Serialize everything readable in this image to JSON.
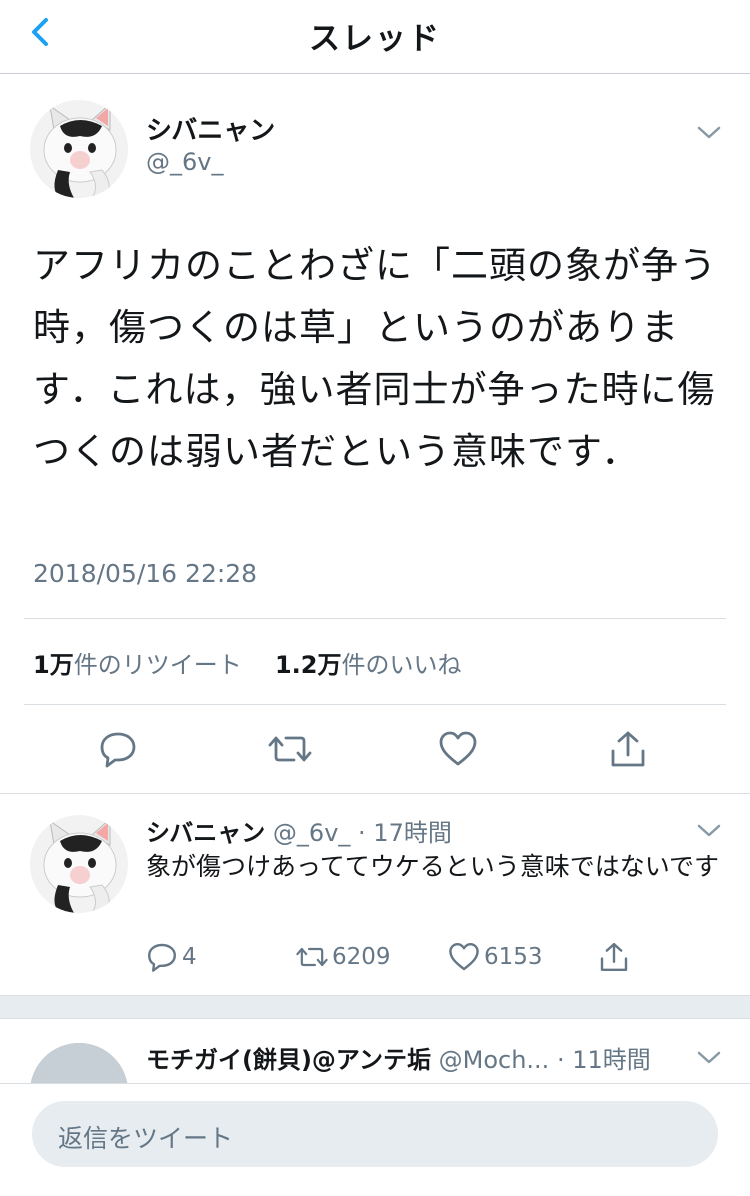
{
  "header": {
    "title": "スレッド"
  },
  "main_tweet": {
    "name": "シバニャン",
    "handle": "@_6v_",
    "text": "アフリカのことわざに「二頭の象が争う時，傷つくのは草」というのがあります．これは，強い者同士が争った時に傷つくのは弱い者だという意味です．",
    "timestamp": "2018/05/16 22:28",
    "retweet_count": "1万",
    "retweet_label": "件のリツイート",
    "like_count": "1.2万",
    "like_label": "件のいいね"
  },
  "reply_tweet": {
    "name": "シバニャン",
    "handle": "@_6v_",
    "time": "· 17時間",
    "text": "象が傷つけあっててウケるという意味ではないです",
    "reply_count": "4",
    "retweet_count": "6209",
    "like_count": "6153"
  },
  "third_tweet": {
    "name": "モチガイ(餅貝)@アンテ垢",
    "handle": "@Moch...",
    "time": "· 11時間"
  },
  "compose": {
    "placeholder": "返信をツイート"
  },
  "icons": {
    "back": "chevron-left-icon",
    "caret": "chevron-down-icon",
    "reply": "reply-bubble-icon",
    "retweet": "retweet-icon",
    "like": "heart-icon",
    "share": "share-icon"
  },
  "colors": {
    "accent": "#1da1f2",
    "secondary_text": "#657786",
    "divider": "#e6ecf0"
  }
}
